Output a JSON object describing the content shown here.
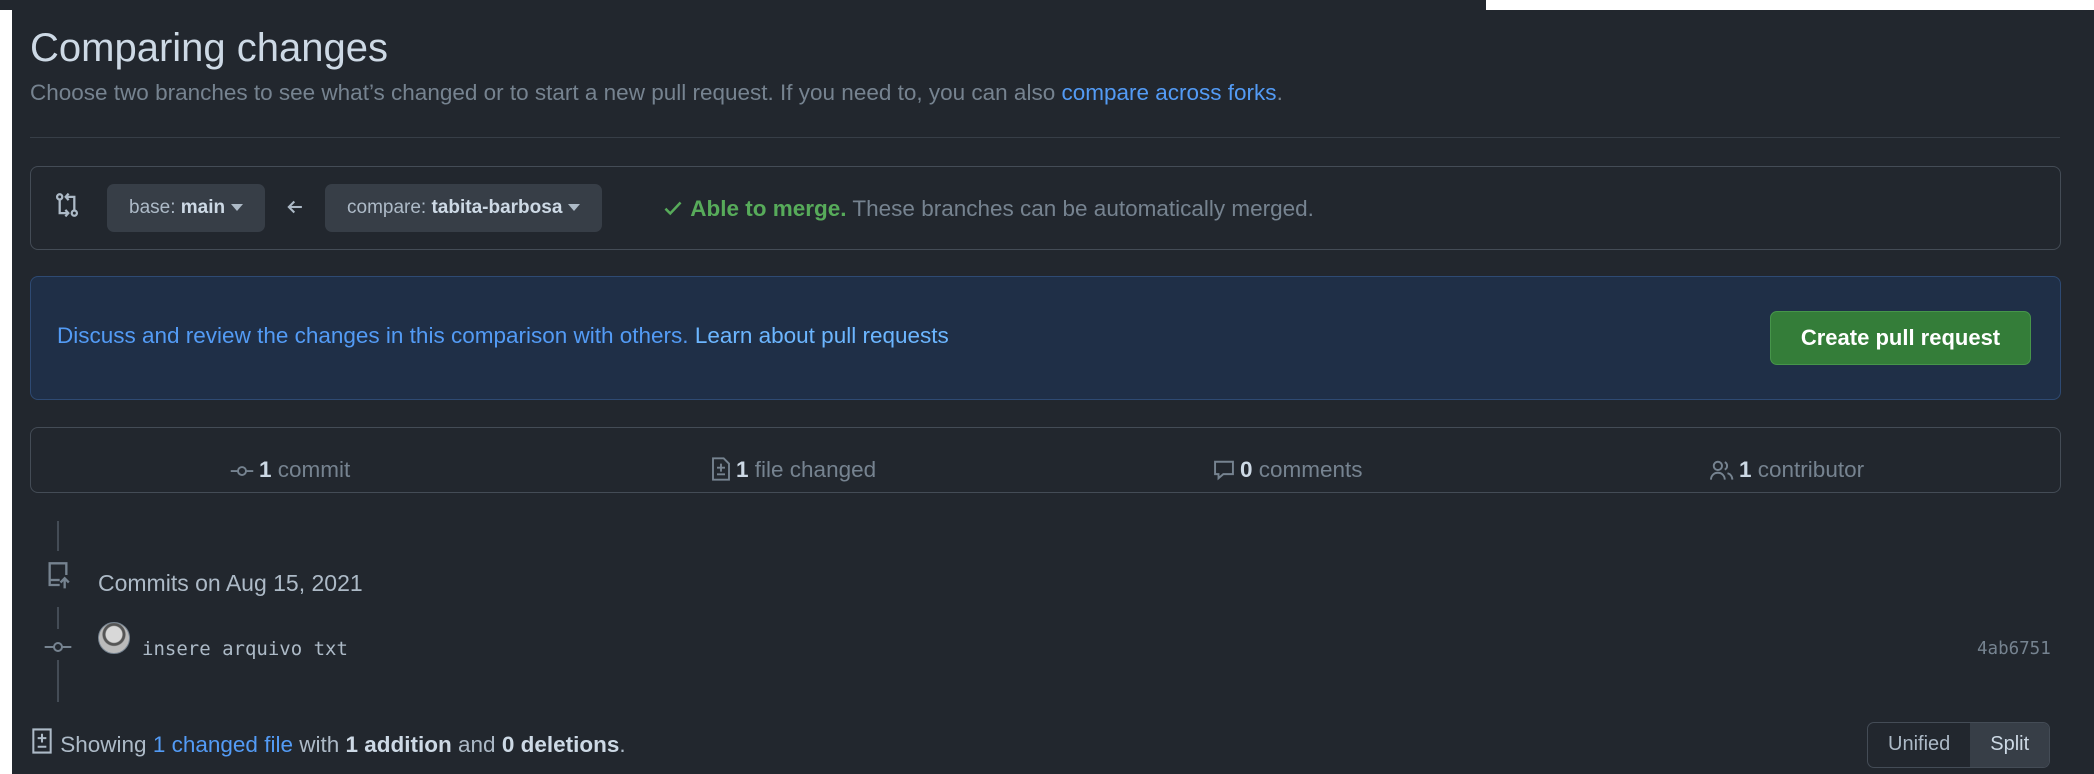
{
  "page": {
    "title": "Comparing changes",
    "subtitle": "Choose two branches to see what’s changed or to start a new pull request. If you need to, you can also",
    "subtitle_link": "compare across forks",
    "subtitle_end": "."
  },
  "range": {
    "base_prefix": "base:",
    "base_branch": "main",
    "compare_prefix": "compare:",
    "compare_branch": "tabita-barbosa",
    "merge_status": "Able to merge.",
    "merge_detail": "These branches can be automatically merged.",
    "status_color": "#57ab5a"
  },
  "flash": {
    "text": "Discuss and review the changes in this comparison with others.",
    "link": "Learn about pull requests",
    "button": "Create pull request"
  },
  "stats": {
    "commits_count": "1",
    "commits_label": "commit",
    "files_count": "1",
    "files_label": "file changed",
    "comments_count": "0",
    "comments_label": "comments",
    "contributors_count": "1",
    "contributors_label": "contributor"
  },
  "commits": {
    "group_label": "Commits on Aug 15, 2021",
    "items": [
      {
        "message": "insere arquivo txt",
        "sha": "4ab6751"
      }
    ]
  },
  "summary": {
    "prefix": "Showing",
    "link": "1 changed file",
    "mid1": "with",
    "additions": "1 addition",
    "mid2": "and",
    "deletions": "0 deletions",
    "end": "."
  },
  "view": {
    "unified": "Unified",
    "split": "Split"
  },
  "icons": [
    "git-compare-icon",
    "arrow-left-icon",
    "check-icon",
    "commit-icon",
    "file-diff-icon",
    "comment-icon",
    "people-icon",
    "repo-push-icon"
  ],
  "colors": {
    "background": "#22272e",
    "accent": "#539bf5",
    "primary_button": "#347d39"
  }
}
